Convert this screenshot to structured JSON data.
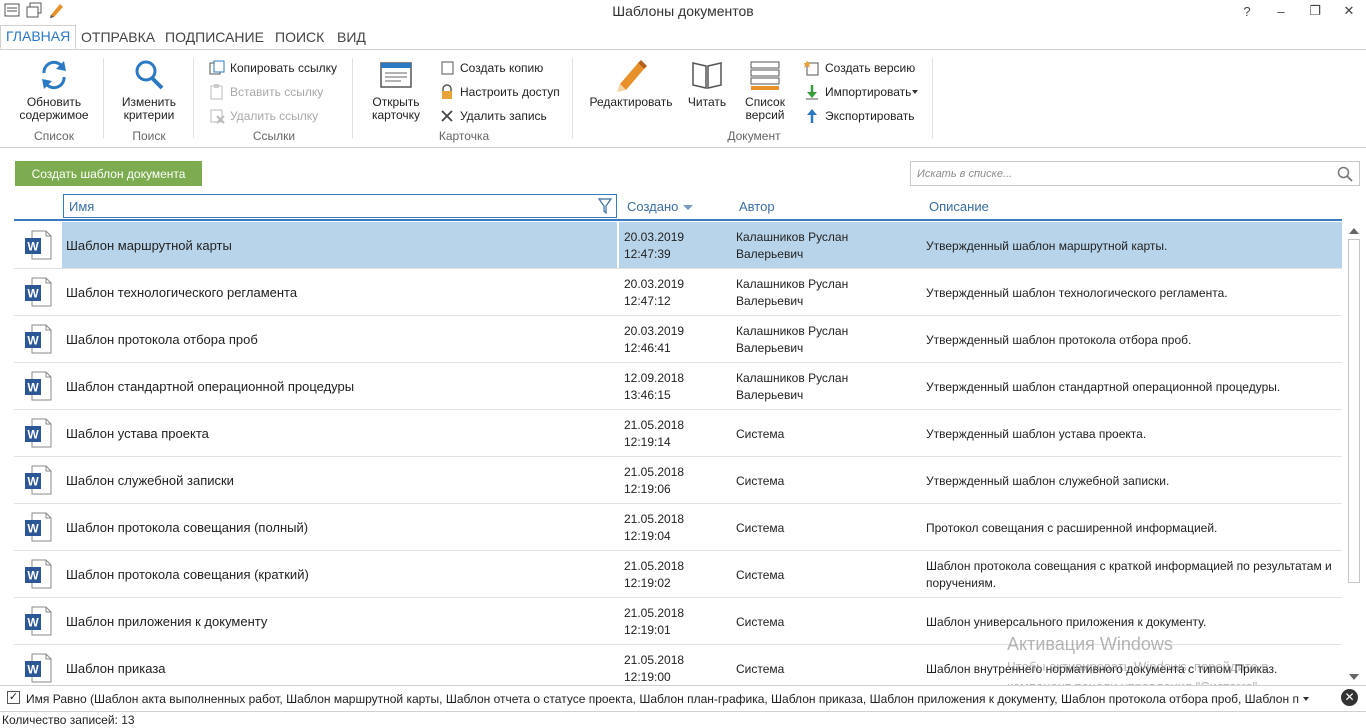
{
  "window": {
    "title": "Шаблоны документов",
    "help": "?",
    "minimize": "–",
    "restore": "❐",
    "close": "✕"
  },
  "tabs": [
    "ГЛАВНАЯ",
    "ОТПРАВКА",
    "ПОДПИСАНИЕ",
    "ПОИСК",
    "ВИД"
  ],
  "ribbon": {
    "list": {
      "refresh": "Обновить содержимое",
      "group": "Список"
    },
    "search": {
      "change_criteria": "Изменить критерии",
      "group": "Поиск"
    },
    "links": {
      "copy": "Копировать ссылку",
      "paste": "Вставить ссылку",
      "delete": "Удалить ссылку",
      "group": "Ссылки"
    },
    "card": {
      "open": "Открыть карточку",
      "create_copy": "Создать копию",
      "access": "Настроить доступ",
      "delete": "Удалить запись",
      "group": "Карточка"
    },
    "document": {
      "edit": "Редактировать",
      "read": "Читать",
      "versions": "Список версий",
      "create_version": "Создать версию",
      "import": "Импортировать",
      "export": "Экспортировать",
      "group": "Документ"
    }
  },
  "create_button": "Создать шаблон документа",
  "search": {
    "placeholder": "Искать в списке..."
  },
  "columns": {
    "name": "Имя",
    "created": "Создано",
    "author": "Автор",
    "description": "Описание"
  },
  "rows": [
    {
      "name": "Шаблон маршрутной карты",
      "date": "20.03.2019",
      "time": "12:47:39",
      "author1": "Калашников Руслан",
      "author2": "Валерьевич",
      "desc": "Утвержденный шаблон маршрутной карты."
    },
    {
      "name": "Шаблон технологического регламента",
      "date": "20.03.2019",
      "time": "12:47:12",
      "author1": "Калашников Руслан",
      "author2": "Валерьевич",
      "desc": "Утвержденный шаблон технологического регламента."
    },
    {
      "name": "Шаблон протокола отбора проб",
      "date": "20.03.2019",
      "time": "12:46:41",
      "author1": "Калашников Руслан",
      "author2": "Валерьевич",
      "desc": "Утвержденный шаблон протокола отбора проб."
    },
    {
      "name": "Шаблон стандартной операционной процедуры",
      "date": "12.09.2018",
      "time": "13:46:15",
      "author1": "Калашников Руслан",
      "author2": "Валерьевич",
      "desc": "Утвержденный шаблон стандартной операционной процедуры."
    },
    {
      "name": "Шаблон устава проекта",
      "date": "21.05.2018",
      "time": "12:19:14",
      "author1": "Система",
      "author2": "",
      "desc": "Утвержденный шаблон устава проекта."
    },
    {
      "name": "Шаблон служебной записки",
      "date": "21.05.2018",
      "time": "12:19:06",
      "author1": "Система",
      "author2": "",
      "desc": "Утвержденный шаблон служебной записки."
    },
    {
      "name": "Шаблон протокола совещания (полный)",
      "date": "21.05.2018",
      "time": "12:19:04",
      "author1": "Система",
      "author2": "",
      "desc": "Протокол совещания с расширенной информацией."
    },
    {
      "name": "Шаблон протокола совещания (краткий)",
      "date": "21.05.2018",
      "time": "12:19:02",
      "author1": "Система",
      "author2": "",
      "desc": "Шаблон протокола совещания с краткой информацией по результатам и поручениям."
    },
    {
      "name": "Шаблон приложения к документу",
      "date": "21.05.2018",
      "time": "12:19:01",
      "author1": "Система",
      "author2": "",
      "desc": "Шаблон универсального приложения к документу."
    },
    {
      "name": "Шаблон приказа",
      "date": "21.05.2018",
      "time": "12:19:00",
      "author1": "Система",
      "author2": "",
      "desc": "Шаблон внутреннего нормативного документа с типом Приказ."
    }
  ],
  "filter": {
    "text": "Имя Равно (Шаблон акта выполненных работ, Шаблон маршрутной карты, Шаблон отчета о статусе проекта, Шаблон план-графика, Шаблон приказа, Шаблон приложения к документу, Шаблон протокола отбора проб, Шаблон п",
    "checked": "✓",
    "close": "✕"
  },
  "status": "Количество записей: 13",
  "watermark": {
    "line1": "Активация Windows",
    "line2": "Чтобы активировать Windows, перейдите в компонент панели управления \"Система\"."
  },
  "colors": {
    "accent": "#2b79c2",
    "green": "#7cac4f",
    "selected": "#b8d4ea",
    "word_blue": "#2b5797"
  }
}
